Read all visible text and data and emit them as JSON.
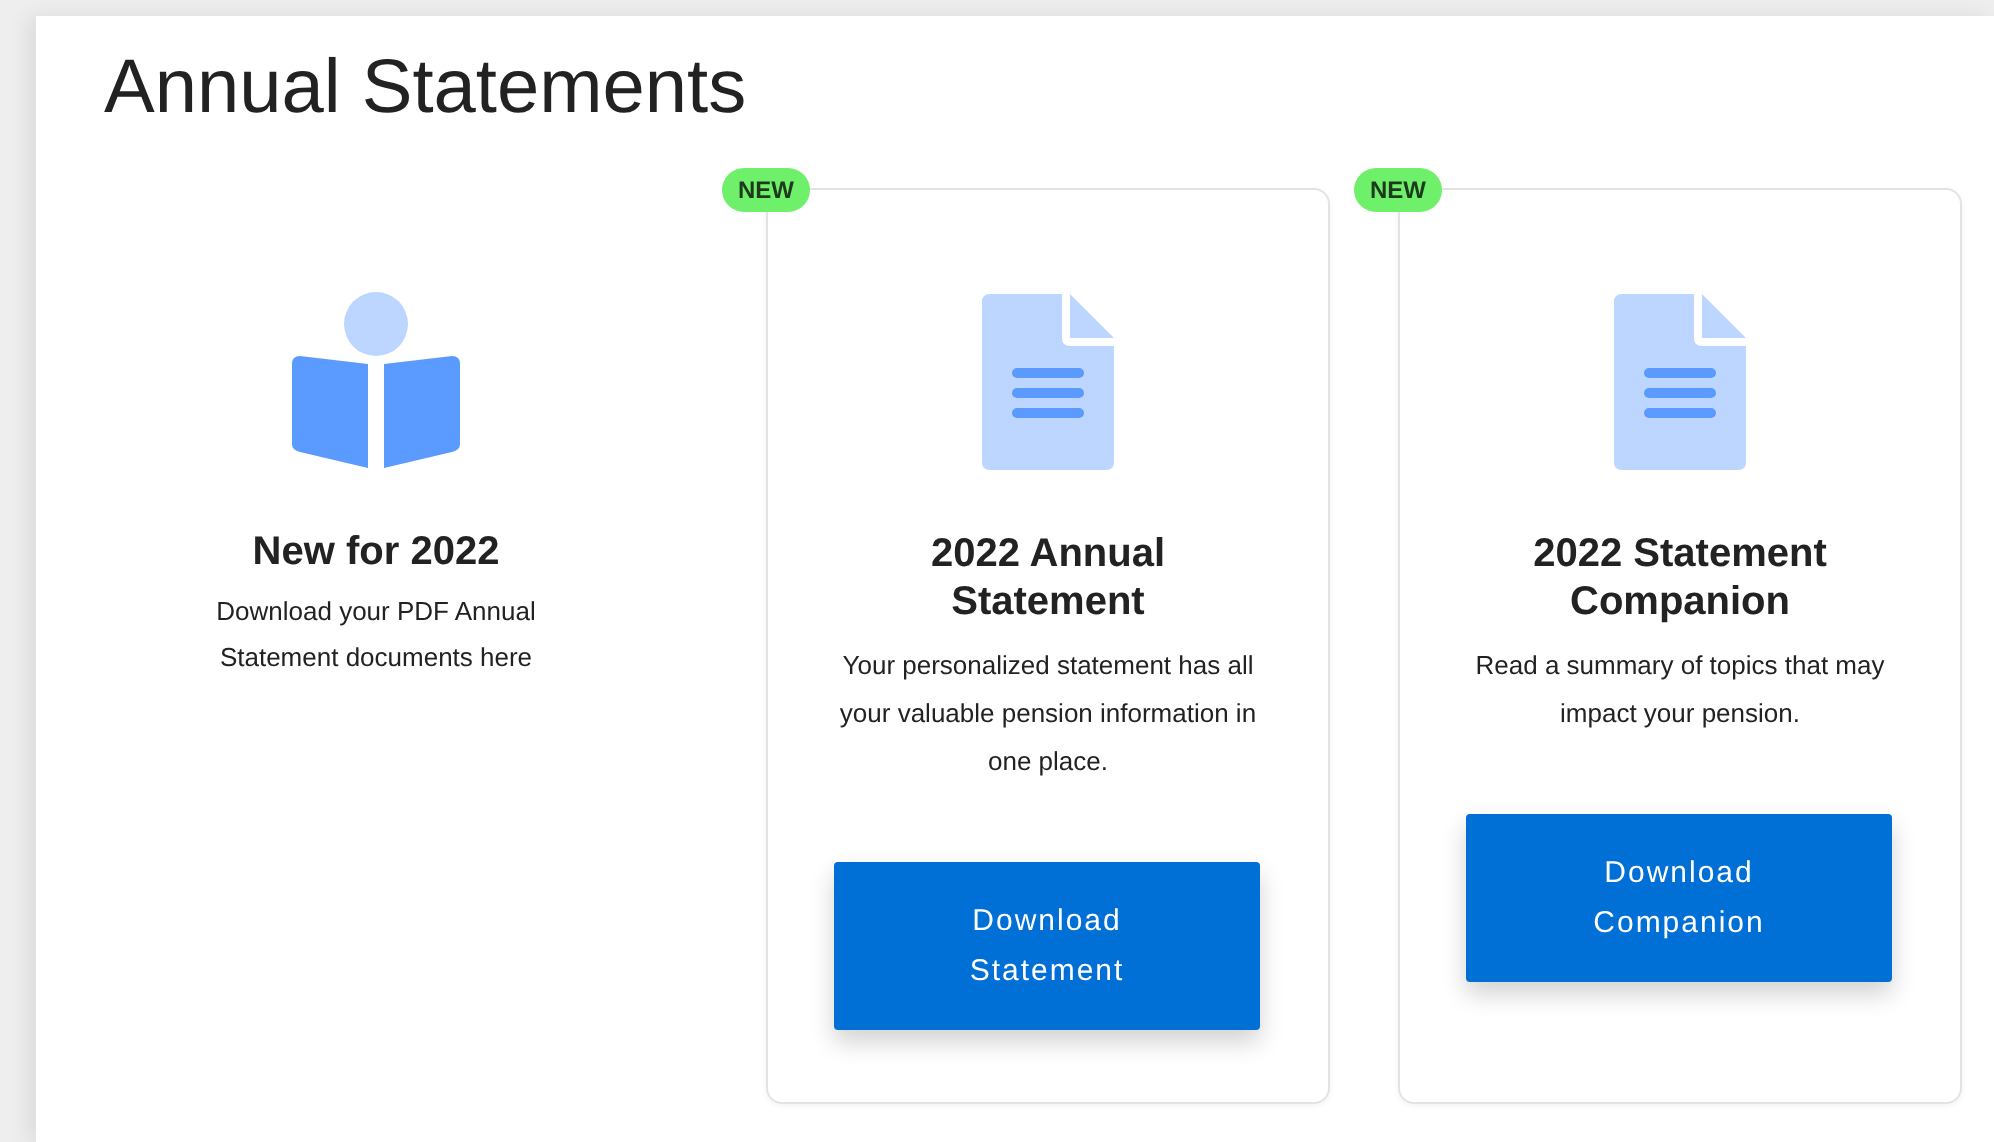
{
  "title": "Annual Statements",
  "items": [
    {
      "kind": "intro",
      "heading": "New for 2022",
      "text": "Download your PDF Annual Statement documents here"
    },
    {
      "kind": "card",
      "badge": "NEW",
      "heading": "2022 Annual Statement",
      "text": "Your personalized statement has all your valuable pension information in one place.",
      "button": "Download Statement"
    },
    {
      "kind": "card",
      "badge": "NEW",
      "heading": "2022 Statement Companion",
      "text": "Read a summary of topics that may impact your pension.",
      "button": "Download Companion"
    }
  ]
}
